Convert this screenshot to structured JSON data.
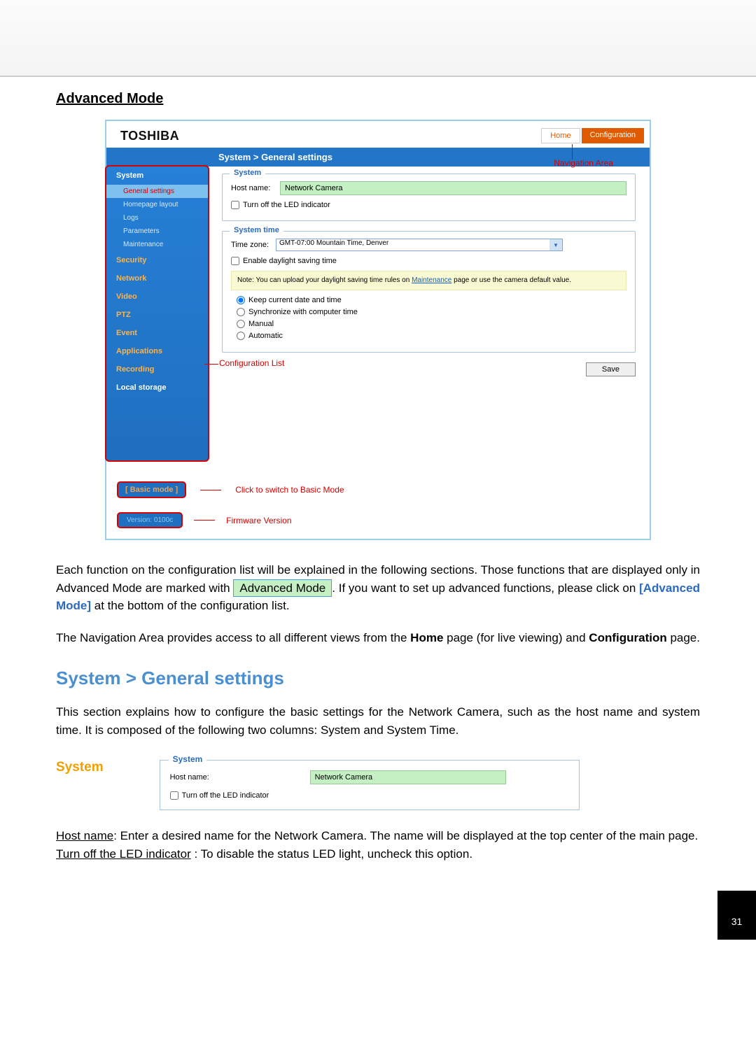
{
  "page_title": "Advanced Mode",
  "brand": "TOSHIBA",
  "tabs": {
    "home": "Home",
    "config": "Configuration"
  },
  "nav_area_label": "Navigation Area",
  "breadcrumb": "System  >  General settings",
  "sidebar": {
    "system": "System",
    "sub": {
      "general": "General settings",
      "homepage": "Homepage layout",
      "logs": "Logs",
      "params": "Parameters",
      "maint": "Maintenance"
    },
    "security": "Security",
    "network": "Network",
    "video": "Video",
    "ptz": "PTZ",
    "event": "Event",
    "apps": "Applications",
    "record": "Recording",
    "storage": "Local storage"
  },
  "fs_system": {
    "legend": "System",
    "hostname_lbl": "Host name:",
    "hostname_val": "Network Camera",
    "led_lbl": "Turn off the LED indicator"
  },
  "fs_time": {
    "legend": "System time",
    "tz_lbl": "Time zone:",
    "tz_val": "GMT-07:00 Mountain Time, Denver",
    "dst_lbl": "Enable daylight saving time",
    "note_pre": "Note: You can upload your daylight saving time rules on ",
    "note_link": "Maintenance",
    "note_post": " page or use the camera default value.",
    "r_keep": "Keep current date and time",
    "r_sync": "Synchronize with computer time",
    "r_manual": "Manual",
    "r_auto": "Automatic"
  },
  "config_list_label": "Configuration List",
  "save_btn": "Save",
  "basic_mode_btn": "[ Basic mode ]",
  "basic_mode_desc": "Click to switch to Basic Mode",
  "version_box": "Version: 0100c",
  "version_desc": "Firmware Version",
  "para1_a": "Each function on the configuration list will be explained in the following sections. Those functions that are displayed only in Advanced Mode are marked with ",
  "para1_badge": "Advanced Mode",
  "para1_b": ". If you want to set up advanced functions, please click on ",
  "para1_bold": "[Advanced Mode]",
  "para1_c": " at the bottom of the configuration list.",
  "para2_a": "The Navigation Area provides access to all different views from the ",
  "para2_home": "Home",
  "para2_b": " page (for live viewing) and ",
  "para2_config": "Configuration",
  "para2_c": " page.",
  "h2": "System > General settings",
  "para3": "This section explains how to configure the basic settings for the Network Camera, such as the host name and system time. It is composed of the following two columns: System and System Time.",
  "system_header": "System",
  "def_hostname_u": "Host name",
  "def_hostname_t": ": Enter a desired name for the Network Camera. The name will be displayed at the top center of the main page.",
  "def_led_u": "Turn off the LED indicator",
  "def_led_t": " : To disable the status LED light, uncheck this option.",
  "page_num": "31"
}
